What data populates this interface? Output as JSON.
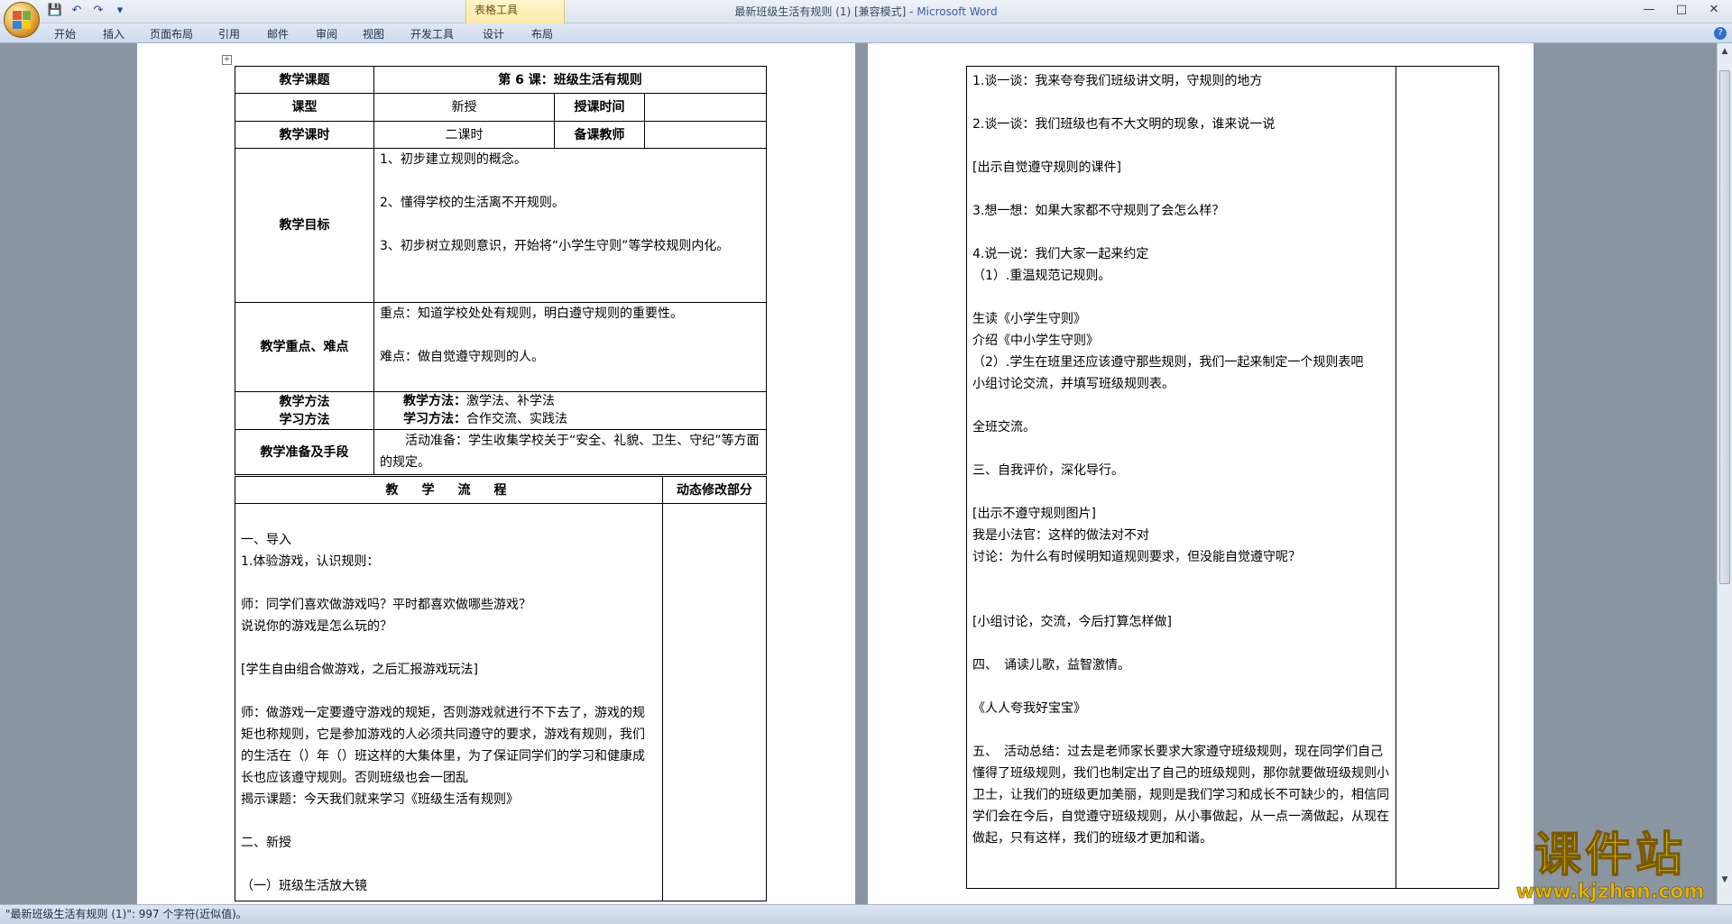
{
  "window": {
    "title": "最新班级生活有规则 (1) [兼容模式] - ",
    "app_name": "Microsoft Word",
    "contextual_group": "表格工具"
  },
  "ribbon": {
    "tabs": [
      "开始",
      "插入",
      "页面布局",
      "引用",
      "邮件",
      "审阅",
      "视图",
      "开发工具",
      "设计",
      "布局"
    ]
  },
  "status_bar": {
    "text": "\"最新班级生活有规则 (1)\": 997 个字符(近似值)。"
  },
  "left_page": {
    "rows": {
      "topic_label": "教学课题",
      "topic_value": "第 6 课：班级生活有规则",
      "type_label": "课型",
      "type_value": "新授",
      "time_label": "授课时间",
      "time_value": "",
      "hours_label": "教学课时",
      "hours_value": "二课时",
      "teacher_label": "备课教师",
      "teacher_value": "",
      "goal_label": "教学目标",
      "goal_lines": [
        "1、初步建立规则的概念。",
        "",
        "2、懂得学校的生活离不开规则。",
        "",
        "3、初步树立规则意识，开始将“小学生守则”等学校规则内化。",
        ""
      ],
      "key_label": "教学重点、难点",
      "key_lines": [
        "重点：知道学校处处有规则，明白遵守规则的重要性。",
        "",
        "难点：做自觉遵守规则的人。",
        ""
      ],
      "method_label_1": "教学方法",
      "method_label_2": "学习方法",
      "method_line_1_label": "教学方法：",
      "method_line_1_value": "激学法、补学法",
      "method_line_2_label": "学习方法：",
      "method_line_2_value": "合作交流、实践法",
      "prep_label": "教学准备及手段",
      "prep_text": "活动准备：学生收集学校关于“安全、礼貌、卫生、守纪”等方面的规定。",
      "flow_header": "教　学　流　程",
      "revision_header": "动态修改部分",
      "flow_lines": [
        "",
        "一、导入",
        "1.体验游戏，认识规则：",
        "",
        "师：同学们喜欢做游戏吗？平时都喜欢做哪些游戏？",
        "说说你的游戏是怎么玩的？",
        "",
        "[学生自由组合做游戏，之后汇报游戏玩法]",
        "",
        "师：做游戏一定要遵守游戏的规矩，否则游戏就进行不下去了，游戏的规矩也称规则，它是参加游戏的人必须共同遵守的要求，游戏有规则，我们的生活在（）年（）班这样的大集体里，为了保证同学们的学习和健康成长也应该遵守规则。否则班级也会一团乱",
        "揭示课题：今天我们就来学习《班级生活有规则》",
        "",
        "二、新授",
        "",
        "（一）班级生活放大镜"
      ]
    }
  },
  "right_page": {
    "lines": [
      "1.谈一谈：我来夸夸我们班级讲文明，守规则的地方",
      "",
      "2.谈一谈：我们班级也有不大文明的现象，谁来说一说",
      "",
      "[出示自觉遵守规则的课件]",
      "",
      "3.想一想：如果大家都不守规则了会怎么样？",
      "",
      "4.说一说：我们大家一起来约定",
      "（1）.重温规范记规则。",
      "",
      "生读《小学生守则》",
      "介绍《中小学生守则》",
      "（2）.学生在班里还应该遵守那些规则，我们一起来制定一个规则表吧",
      "小组讨论交流，并填写班级规则表。",
      "",
      "全班交流。",
      "",
      "三、自我评价，深化导行。",
      "",
      "[出示不遵守规则图片]",
      "我是小法官：这样的做法对不对",
      "讨论：为什么有时候明知道规则要求，但没能自觉遵守呢？",
      "",
      "",
      "[小组讨论，交流，今后打算怎样做]",
      "",
      "四、　诵读儿歌，益智激情。",
      "",
      "《人人夸我好宝宝》",
      "",
      "五、　活动总结：过去是老师家长要求大家遵守班级规则，现在同学们自己懂得了班级规则，我们也制定出了自己的班级规则，那你就要做班级规则小卫士，让我们的班级更加美丽，规则是我们学习和成长不可缺少的，相信同学们会在今后，自觉遵守班级规则，从小事做起，从一点一滴做起，从现在做起，只有这样，我们的班级才更加和谐。"
    ]
  },
  "watermark": {
    "big": "课件站",
    "small": "www.kjzhan.com"
  },
  "icons": {
    "office_button": "office-logo-icon",
    "save": "save-icon",
    "undo": "undo-icon",
    "redo": "redo-icon",
    "help": "help-icon"
  }
}
